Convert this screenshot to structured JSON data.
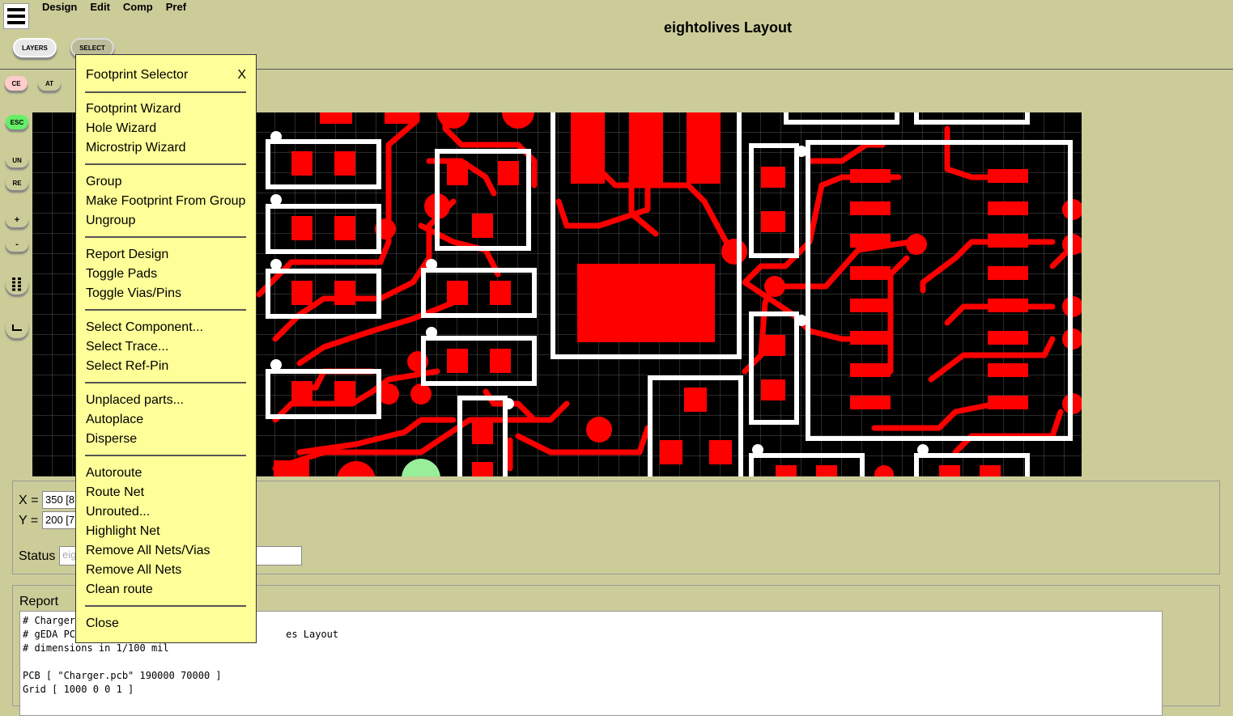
{
  "app": {
    "title": "eightolives Layout"
  },
  "menubar": [
    "Design",
    "Edit",
    "Comp",
    "Pref"
  ],
  "toolbar": {
    "layers_label": "LAYERS",
    "select_label": "SELECT"
  },
  "side_buttons": {
    "ce": "CE",
    "at": "AT",
    "esc": "ESC",
    "undo": "UN",
    "redo": "RE",
    "zoom_in": "+",
    "zoom_out": "-",
    "grid_icon": "grid-icon",
    "corner_icon": "corner-icon"
  },
  "coords": {
    "x_label": "X =",
    "x_value": "350 [8",
    "y_label": "Y =",
    "y_value": "200 [7",
    "status_label": "Status",
    "status_placeholder": "eig"
  },
  "report": {
    "label": "Report",
    "lines": [
      "# Charger",
      "# gEDA PC                                    es Layout",
      "# dimensions in 1/100 mil",
      "",
      "PCB [ \"Charger.pcb\" 190000 70000 ]",
      "Grid [ 1000 0 0 1 ]"
    ]
  },
  "menu": {
    "title": "Footprint Selector",
    "close": "X",
    "groups": [
      [
        "Footprint Wizard",
        "Hole Wizard",
        "Microstrip Wizard"
      ],
      [
        "Group",
        "Make Footprint From Group",
        "Ungroup"
      ],
      [
        "Report Design",
        "Toggle Pads",
        "Toggle Vias/Pins"
      ],
      [
        "Select Component...",
        "Select Trace...",
        "Select Ref-Pin"
      ],
      [
        "Unplaced parts...",
        "Autoplace",
        "Disperse"
      ],
      [
        "Autoroute",
        "Route Net",
        "Unrouted...",
        "Highlight Net",
        "Remove All Nets/Vias",
        "Remove All Nets",
        "Clean route"
      ],
      [
        "Close"
      ]
    ]
  },
  "colors": {
    "background": "#cccc99",
    "menu": "#ffff99",
    "copper": "#ff0000",
    "silk": "#ffffff",
    "board": "#000000",
    "grid": "#555555"
  }
}
